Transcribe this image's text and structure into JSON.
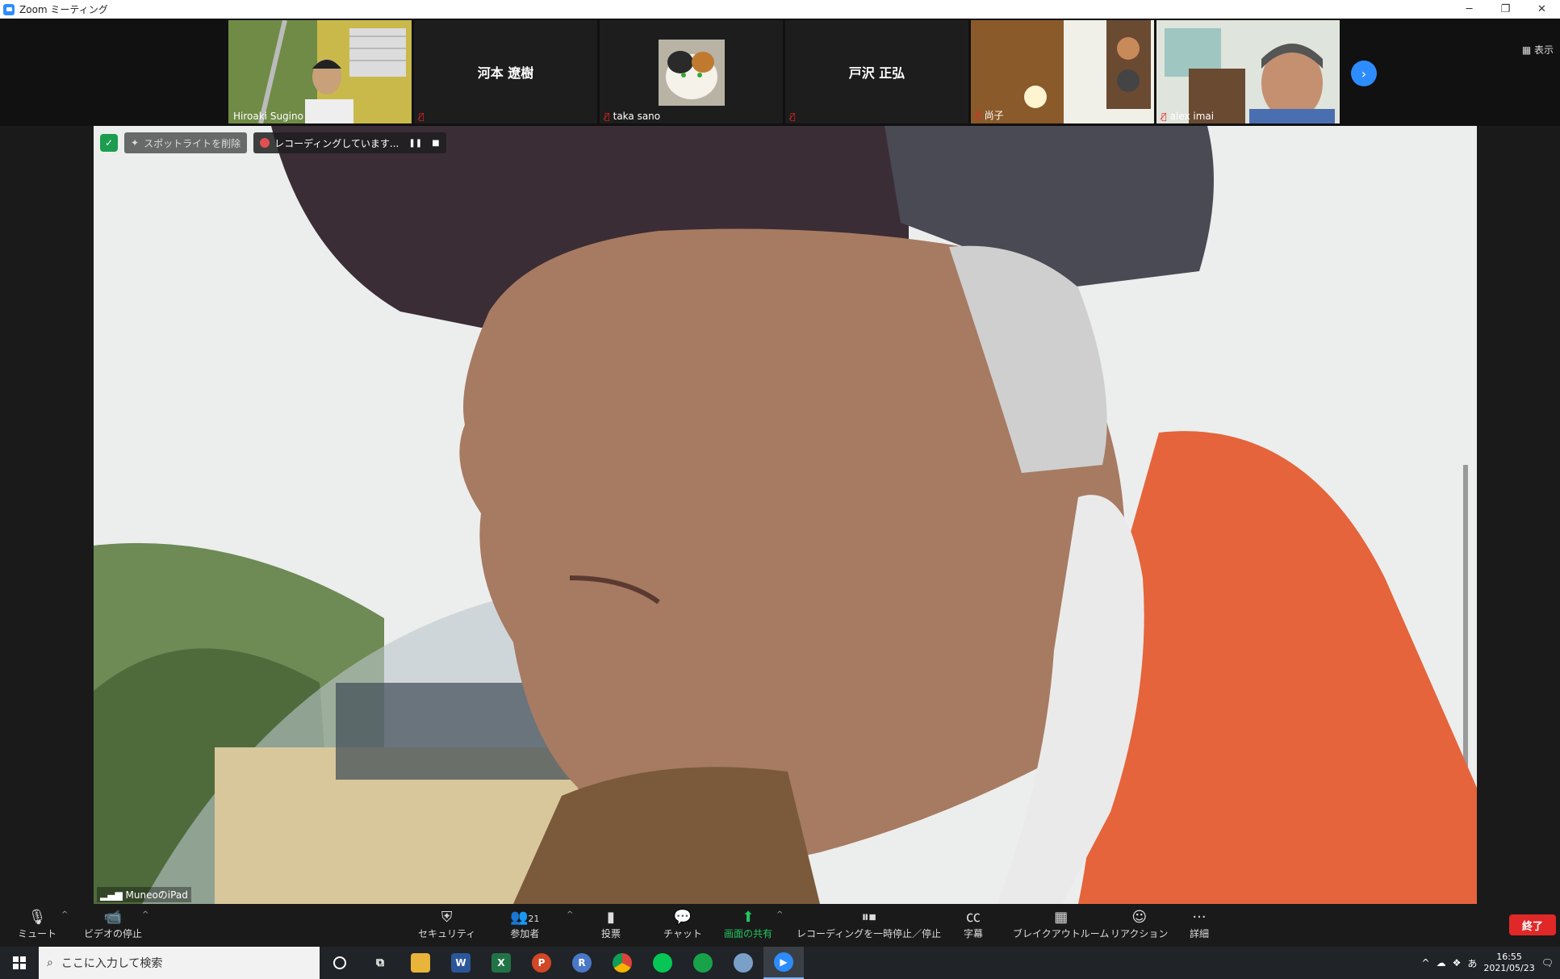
{
  "window": {
    "title": "Zoom ミーティング",
    "minimize": "─",
    "restore": "❐",
    "close": "✕"
  },
  "strip": {
    "view_label": "▦ 表示",
    "participants": [
      {
        "name": "Hiroaki Sugino"
      },
      {
        "name": "河本 遼樹"
      },
      {
        "name": "taka sano"
      },
      {
        "name": "戸沢 正弘"
      },
      {
        "name": "尚子"
      },
      {
        "name": "alex imai"
      }
    ]
  },
  "main": {
    "spotlight_label": "スポットライトを削除",
    "recording_label": "レコーディングしています...",
    "pause_glyph": "❚❚",
    "stop_glyph": "■",
    "speaker_label": "MuneoのiPad"
  },
  "toolbar": {
    "mute": "ミュート",
    "video": "ビデオの停止",
    "security": "セキュリティ",
    "participants": "参加者",
    "participants_count": "21",
    "poll": "投票",
    "chat": "チャット",
    "share": "画面の共有",
    "recording": "レコーディングを一時停止／停止",
    "cc": "字幕",
    "breakout": "ブレイクアウトルーム",
    "reaction": "リアクション",
    "more": "詳細",
    "end": "終了"
  },
  "taskbar": {
    "search_placeholder": "ここに入力して検索",
    "ime": "あ",
    "time": "16:55",
    "date": "2021/05/23"
  },
  "colors": {
    "accent": "#2D8CFF",
    "end": "#E02828",
    "share_green": "#22C55E",
    "mic_off": "#E02222"
  }
}
